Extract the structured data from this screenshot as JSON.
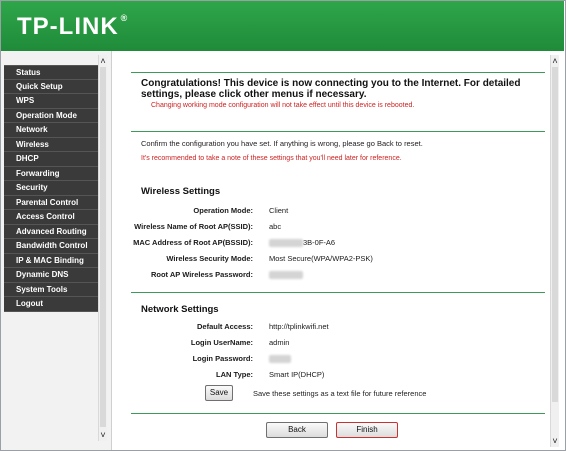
{
  "header": {
    "logo_text": "TP-LINK",
    "logo_mark": "®",
    "brand_color": "#2a9a46"
  },
  "sidebar": {
    "items": [
      {
        "label": "Status"
      },
      {
        "label": "Quick Setup"
      },
      {
        "label": "WPS"
      },
      {
        "label": "Operation Mode"
      },
      {
        "label": "Network"
      },
      {
        "label": "Wireless"
      },
      {
        "label": "DHCP"
      },
      {
        "label": "Forwarding"
      },
      {
        "label": "Security"
      },
      {
        "label": "Parental Control"
      },
      {
        "label": "Access Control"
      },
      {
        "label": "Advanced Routing"
      },
      {
        "label": "Bandwidth Control"
      },
      {
        "label": "IP & MAC Binding"
      },
      {
        "label": "Dynamic DNS"
      },
      {
        "label": "System Tools"
      },
      {
        "label": "Logout"
      }
    ]
  },
  "main": {
    "congrats_line1": "Congratulations! This device is now connecting you to the Internet. For detailed",
    "congrats_line2": "settings, please click other menus if necessary.",
    "reboot_warning": "Changing working mode configuration will not take effect until this device is rebooted.",
    "confirm_text": "Confirm the configuration you have set. If anything is wrong, please go Back to reset.",
    "note_text": "It's recommended to take a note of these settings that you'll need later for reference.",
    "wireless": {
      "title": "Wireless Settings",
      "operation_mode_label": "Operation Mode:",
      "operation_mode_value": "Client",
      "ssid_label": "Wireless Name of Root AP(SSID):",
      "ssid_value": "abc",
      "bssid_label": "MAC Address of Root AP(BSSID):",
      "bssid_value_suffix": "3B-0F-A6",
      "security_label": "Wireless Security Mode:",
      "security_value": "Most Secure(WPA/WPA2-PSK)",
      "password_label": "Root AP Wireless Password:"
    },
    "network": {
      "title": "Network Settings",
      "default_access_label": "Default Access:",
      "default_access_value": "http://tplinkwifi.net",
      "username_label": "Login UserName:",
      "username_value": "admin",
      "password_label": "Login Password:",
      "lan_type_label": "LAN Type:",
      "lan_type_value": "Smart IP(DHCP)"
    },
    "save_button": "Save",
    "save_hint": "Save these settings as a text file for future reference",
    "back_button": "Back",
    "finish_button": "Finish"
  },
  "colors": {
    "warning_red": "#cc2222",
    "divider_green": "#3c9a5a",
    "finish_outline": "#c83232"
  }
}
